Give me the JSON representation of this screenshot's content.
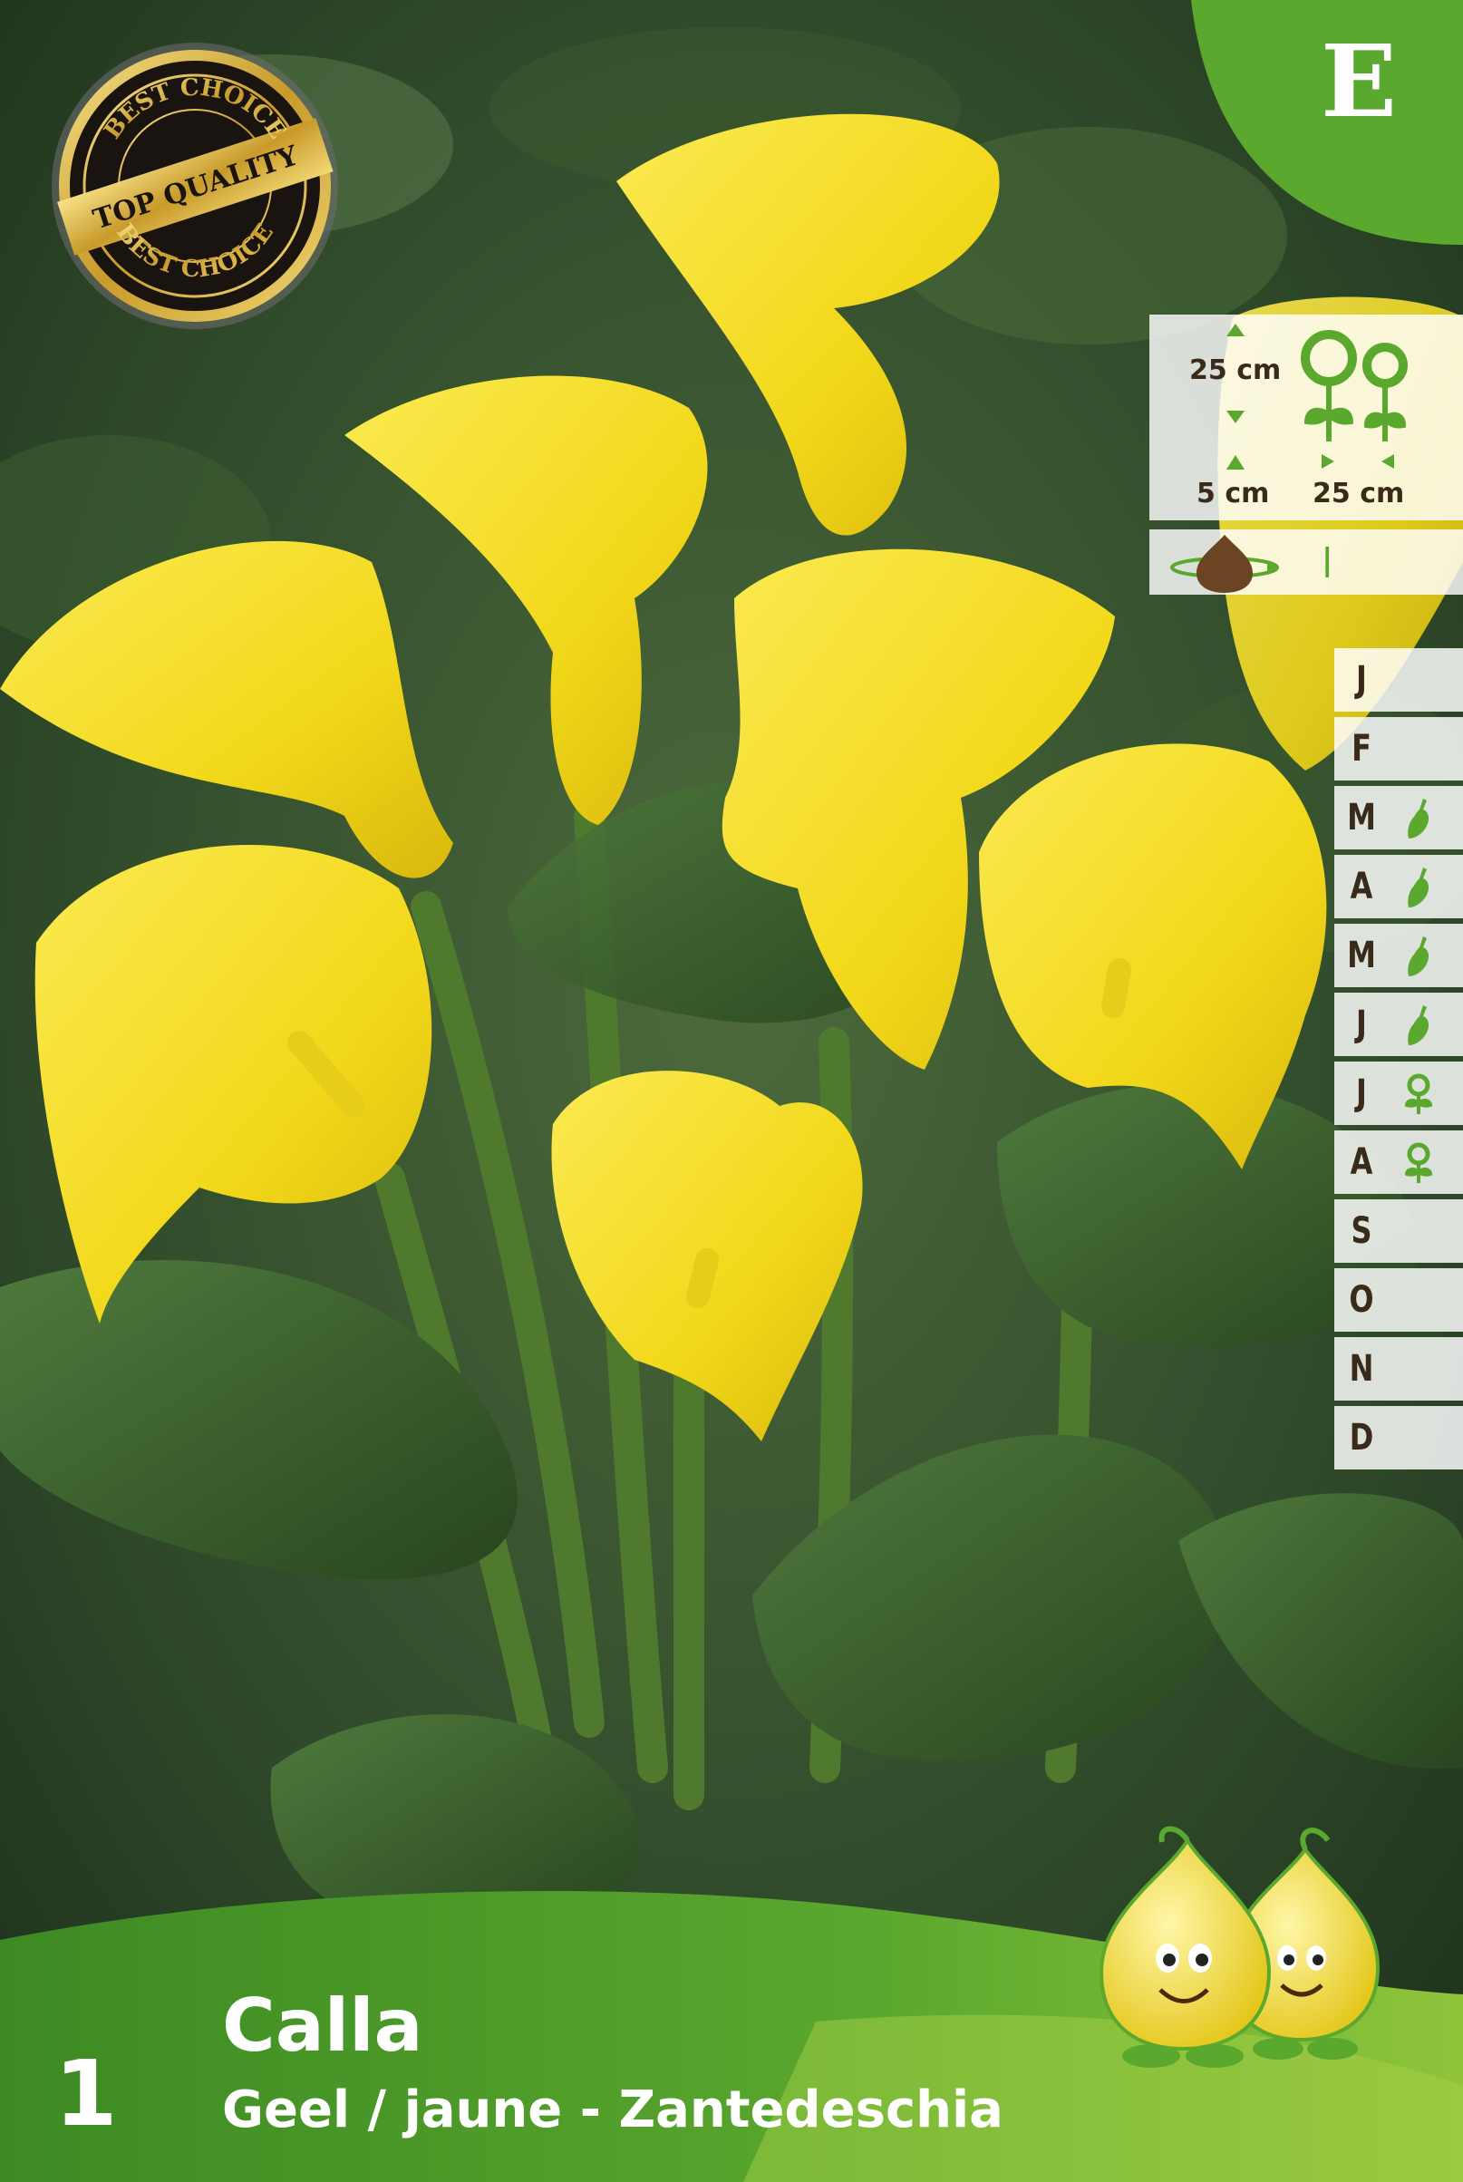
{
  "package": {
    "name": "Calla",
    "subtitle": "Geel / jaune - Zantedeschia",
    "quantity": "1",
    "category_letter": "E"
  },
  "badge": {
    "top_text": "BEST CHOICE",
    "center_text": "TOP QUALITY",
    "bottom_text": "BEST CHOICE"
  },
  "planting": {
    "height_label": "25 cm",
    "depth_label": "5 cm",
    "spacing_label": "25 cm",
    "orientation_mark": "|"
  },
  "calendar": {
    "months": [
      {
        "letter": "J",
        "icon": ""
      },
      {
        "letter": "F",
        "icon": ""
      },
      {
        "letter": "M",
        "icon": "trowel-icon"
      },
      {
        "letter": "A",
        "icon": "trowel-icon"
      },
      {
        "letter": "M",
        "icon": "trowel-icon"
      },
      {
        "letter": "J",
        "icon": "trowel-icon"
      },
      {
        "letter": "J",
        "icon": "flower-icon"
      },
      {
        "letter": "A",
        "icon": "flower-icon"
      },
      {
        "letter": "S",
        "icon": ""
      },
      {
        "letter": "O",
        "icon": ""
      },
      {
        "letter": "N",
        "icon": ""
      },
      {
        "letter": "D",
        "icon": ""
      }
    ]
  },
  "colors": {
    "brand_green": "#5aa82e",
    "bottom_band": "#4e9c2a",
    "calendar_icon": "#5aa82e",
    "text_brown": "#3a2a1a",
    "flower_yellow": "#f2de1c"
  }
}
